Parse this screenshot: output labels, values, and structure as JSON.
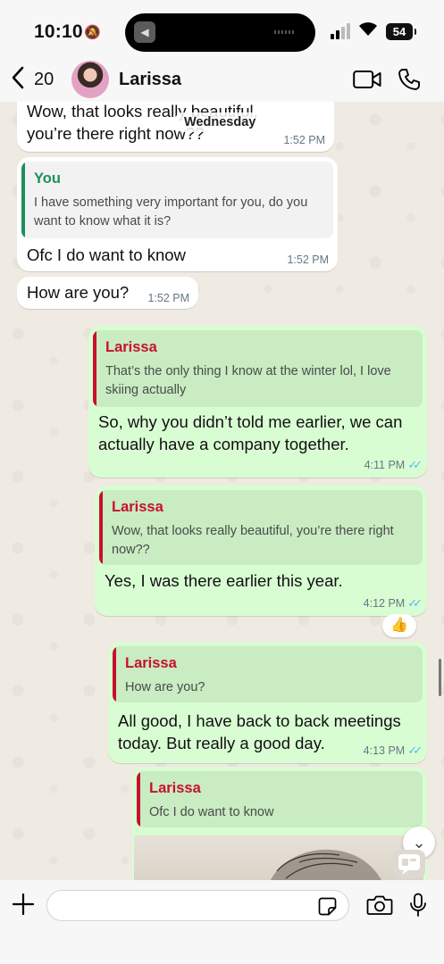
{
  "status_bar": {
    "time": "10:10",
    "battery": "54"
  },
  "header": {
    "back_count": "20",
    "contact_name": "Larissa"
  },
  "day_separator": "Wednesday",
  "messages": [
    {
      "text": "Wow, that looks really beautiful, you’re there right now??",
      "time": "1:52 PM"
    },
    {
      "quote_author": "You",
      "quote_text": "I have something very important for you, do you want to know what it is?",
      "text": "Ofc I do want to know",
      "time": "1:52 PM"
    },
    {
      "text": "How are you?",
      "time": "1:52 PM"
    },
    {
      "quote_author": "Larissa",
      "quote_text": "That’s the only thing I know at the winter lol, I love skiing actually",
      "text": "So, why you didn’t told me earlier, we can actually have a company together.",
      "time": "4:11 PM"
    },
    {
      "quote_author": "Larissa",
      "quote_text": "Wow, that looks really beautiful, you’re there right now??",
      "text": "Yes, I was there earlier this year.",
      "time": "4:12 PM",
      "reaction": "👍"
    },
    {
      "quote_author": "Larissa",
      "quote_text": "How are you?",
      "text": "All good, I have back to back meetings today. But really a good day.",
      "time": "4:13 PM"
    },
    {
      "quote_author": "Larissa",
      "quote_text": "Ofc I do want to know"
    }
  ],
  "colors": {
    "incoming_bubble": "#ffffff",
    "outgoing_bubble": "#d9fdd3",
    "quote_you": "#1f8f5a",
    "quote_contact": "#c8102e",
    "read_ticks": "#53bdeb"
  },
  "input": {
    "value": "",
    "placeholder": ""
  },
  "icons": [
    "chevron-left-icon",
    "video-call-icon",
    "phone-icon",
    "plus-icon",
    "sticker-icon",
    "camera-icon",
    "microphone-icon",
    "chevron-down-icon",
    "thumbs-up-icon"
  ]
}
